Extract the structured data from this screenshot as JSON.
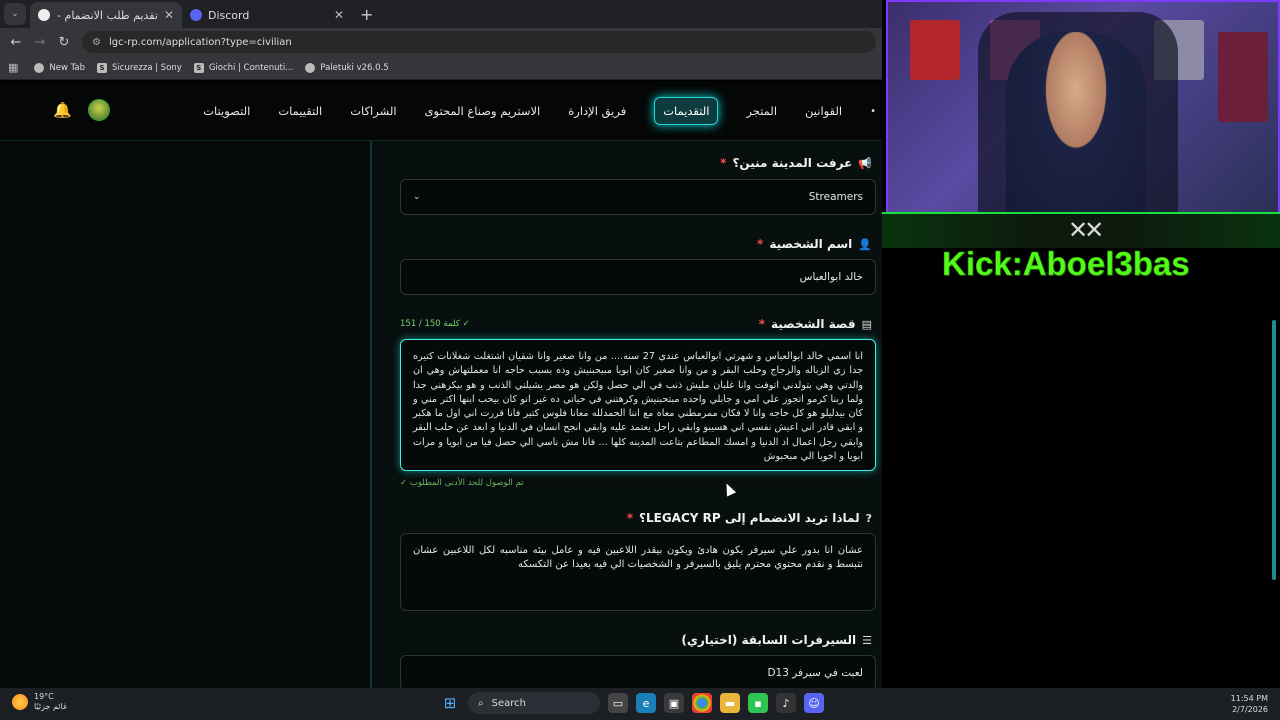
{
  "browser": {
    "tabs": [
      {
        "title": "تقديم طلب الانضمام - LEGACY RP",
        "active": true
      },
      {
        "title": "Discord",
        "active": false
      }
    ],
    "url": "lgc-rp.com/application?type=civilian",
    "bookmarks": [
      "New Tab",
      "Sicurezza | Sony",
      "Giochi | Contenuti...",
      "Paletuki v26.0.5"
    ]
  },
  "nav": {
    "items": [
      "القوانين",
      "المتجر",
      "التقديمات",
      "فريق الإدارة",
      "الاستريم وصناع المحتوى",
      "الشراكات",
      "التقييمات",
      "التصويتات"
    ],
    "active_index": 2
  },
  "form": {
    "heard_label": "عرفت المدينة منين؟",
    "heard_value": "Streamers",
    "name_label": "اسم الشخصية",
    "name_value": "خالد ابوالعباس",
    "story_label": "قصة الشخصية",
    "story_counter": "151 / 150 كلمة ✓",
    "story_text": "انا اسمي خالد ابوالعباس و شهرتي ابوالعباس  عندي 27 سنه....  من وانا صغير وانا شقيان اشتغلت شغلانات كتيره جدا زي الزباله والزجاج  وحلب البقر  و من وانا صغير كان ابويا مبيحبنيش وده بسبب حاجه انا معملتهاش وهي ان والدتي وهي بتولدني اتوفت وانا غلبان مليش ذنب في الي حصل ولكن هو مصر يشيلني الذنب و هو بيكرهني جدا  ولما ربنا كرمو اتجوز علي امي و جابلي واحده مبتحبنيش وكرهتني في حياتي ده غير انو كان بيحب ابنها  اكتر مني و كان بيدليلو هو كل حاجه وانا لا فكان ممرمطني معاه مع اننا الحمدلله معانا فلوس كتير فانا قررت اني اول ما هكبر و ابقي قادر اني اعيش نفسي اني هسيبو وابقي راجل يعتمد عليه وابقي انجح  انسان في الدنيا و ابعد عن  حلب البقر وابقي رجل اعمال اد الدنيا و امسك المطاعم بتاعت المدينه كلها ... فانا مش ناسي الي حصل فيا من ابويا و مرات ابويا و اخويا الي مبحبوش",
    "story_min": "تم الوصول للحد الأدنى المطلوب ✓",
    "why_label": "لماذا تريد الانضمام إلى LEGACY RP؟",
    "why_text": "عشان انا بدور علي سيرفر يكون هادئ ويكون بيقدر اللاعبين فيه و عامل بيئه مناسبه  لكل اللاعبين  عشان نتبسط و نقدم محتوي محترم يليق بالسيرفر  و الشخصيات الي فيه  بعيدا عن التكسكه",
    "prev_label": "السيرفرات السابقة (اختياري)",
    "prev_value": "لعبت في سيرفر D13"
  },
  "stream": {
    "overlay_text": "Kick:Aboel3bas"
  },
  "taskbar": {
    "temp": "19°C",
    "weather_desc": "غائم جزئيًا",
    "search": "Search",
    "time": "11:54 PM",
    "date": "2/7/2026"
  }
}
